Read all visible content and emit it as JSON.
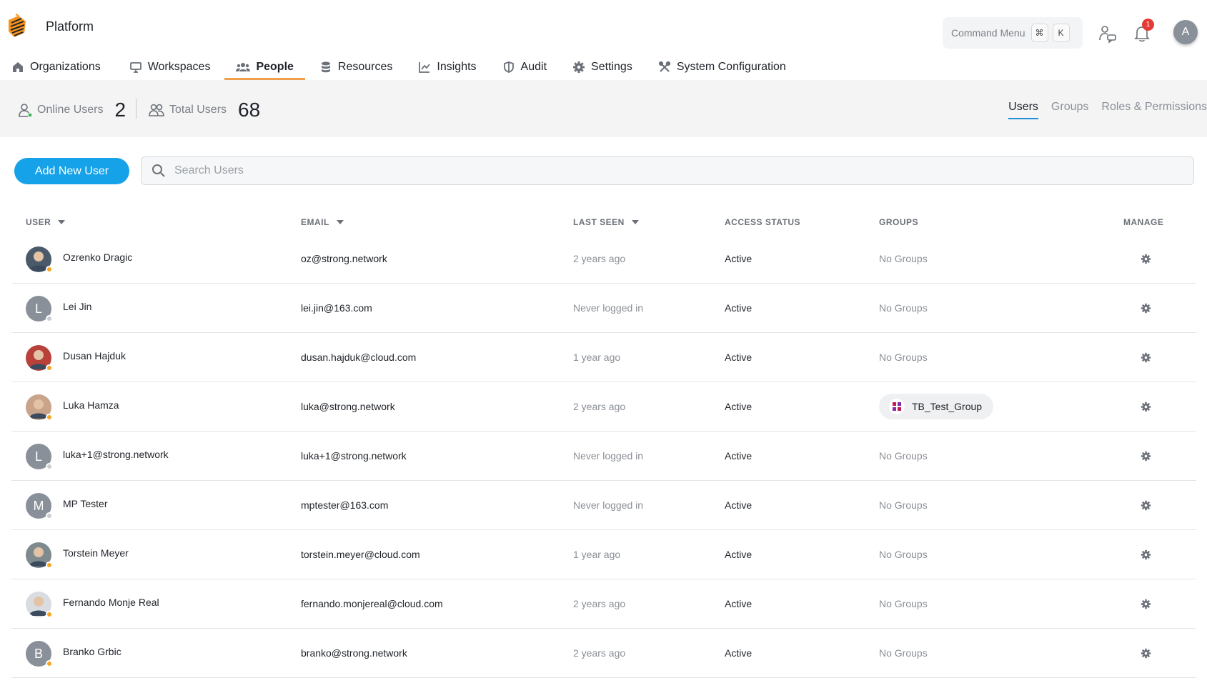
{
  "brand": {
    "name": "Platform"
  },
  "command_menu": {
    "label": "Command Menu",
    "key1": "⌘",
    "key2": "K"
  },
  "notifications": {
    "count": "1"
  },
  "account": {
    "initial": "A"
  },
  "nav": {
    "items": [
      {
        "label": "Organizations",
        "icon": "home-icon"
      },
      {
        "label": "Workspaces",
        "icon": "monitor-icon"
      },
      {
        "label": "People",
        "icon": "people-icon",
        "active": true
      },
      {
        "label": "Resources",
        "icon": "database-icon"
      },
      {
        "label": "Insights",
        "icon": "chart-icon"
      },
      {
        "label": "Audit",
        "icon": "shield-icon"
      },
      {
        "label": "Settings",
        "icon": "gear-icon"
      },
      {
        "label": "System Configuration",
        "icon": "tools-icon"
      }
    ]
  },
  "stats": {
    "online_label": "Online Users",
    "online_value": "2",
    "total_label": "Total Users",
    "total_value": "68"
  },
  "subtabs": {
    "users": "Users",
    "groups": "Groups",
    "roles": "Roles & Permissions"
  },
  "actions": {
    "add_user": "Add New User"
  },
  "search": {
    "placeholder": "Search Users"
  },
  "table": {
    "headers": {
      "user": "USER",
      "email": "EMAIL",
      "last_seen": "LAST SEEN",
      "access_status": "ACCESS STATUS",
      "groups": "GROUPS",
      "manage": "MANAGE"
    },
    "rows": [
      {
        "name": "Ozrenko Dragic",
        "email": "oz@strong.network",
        "last_seen": "2 years ago",
        "status": "Active",
        "groups": "No Groups",
        "avatar": "photo",
        "avatar_color": "#4a5a6a",
        "presence": "#f5a623"
      },
      {
        "name": "Lei Jin",
        "email": "lei.jin@163.com",
        "last_seen": "Never logged in",
        "status": "Active",
        "groups": "No Groups",
        "avatar": "L",
        "avatar_color": "#8a9099",
        "presence": "#c9ccd1"
      },
      {
        "name": "Dusan Hajduk",
        "email": "dusan.hajduk@cloud.com",
        "last_seen": "1 year ago",
        "status": "Active",
        "groups": "No Groups",
        "avatar": "photo",
        "avatar_color": "#b8413a",
        "presence": "#f5a623"
      },
      {
        "name": "Luka Hamza",
        "email": "luka@strong.network",
        "last_seen": "2 years ago",
        "status": "Active",
        "groups": "TB_Test_Group",
        "group_chip": true,
        "avatar": "photo",
        "avatar_color": "#c9a48a",
        "presence": "#f5a623"
      },
      {
        "name": "luka+1@strong.network",
        "email": "luka+1@strong.network",
        "last_seen": "Never logged in",
        "status": "Active",
        "groups": "No Groups",
        "avatar": "L",
        "avatar_color": "#8a9099",
        "presence": "#c9ccd1"
      },
      {
        "name": "MP Tester",
        "email": "mptester@163.com",
        "last_seen": "Never logged in",
        "status": "Active",
        "groups": "No Groups",
        "avatar": "M",
        "avatar_color": "#8a9099",
        "presence": "#c9ccd1"
      },
      {
        "name": "Torstein Meyer",
        "email": "torstein.meyer@cloud.com",
        "last_seen": "1 year ago",
        "status": "Active",
        "groups": "No Groups",
        "avatar": "photo",
        "avatar_color": "#7f8a8f",
        "presence": "#f5a623"
      },
      {
        "name": "Fernando Monje Real",
        "email": "fernando.monjereal@cloud.com",
        "last_seen": "2 years ago",
        "status": "Active",
        "groups": "No Groups",
        "avatar": "photo",
        "avatar_color": "#d9dde2",
        "presence": "#f5a623"
      },
      {
        "name": "Branko Grbic",
        "email": "branko@strong.network",
        "last_seen": "2 years ago",
        "status": "Active",
        "groups": "No Groups",
        "avatar": "B",
        "avatar_color": "#8a9099",
        "presence": "#f5a623"
      }
    ]
  },
  "colors": {
    "accent": "#16a2e8",
    "nav_active": "#f0a04b",
    "presence_away": "#f5a623",
    "presence_offline": "#c9ccd1",
    "badge": "#e53935"
  }
}
